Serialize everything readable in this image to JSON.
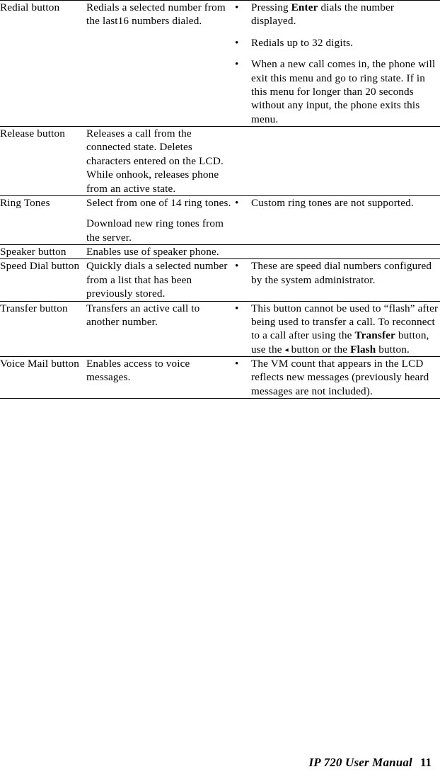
{
  "document": {
    "type": "table",
    "footer": {
      "manual_title": "IP 720 User Manual",
      "page_number": "11"
    }
  },
  "table": {
    "rows": [
      {
        "feature": "Redial button",
        "description": [
          "Redials a selected number from the last16 numbers dialed."
        ],
        "notes": [
          {
            "prefix": "Pressing ",
            "bold": "Enter",
            "suffix": " dials the number displayed."
          },
          {
            "prefix": "Redials up to 32 digits.",
            "bold": "",
            "suffix": ""
          },
          {
            "prefix": "When a new call comes in, the phone will exit this menu and go to ring state. If in this menu for longer than 20 seconds without any input, the phone exits this menu.",
            "bold": "",
            "suffix": ""
          }
        ]
      },
      {
        "feature": "Release button",
        "description": [
          "Releases a call from the connected state. Deletes characters entered on the LCD. While onhook, releases phone from an active state."
        ],
        "notes": []
      },
      {
        "feature": "Ring Tones",
        "description": [
          "Select from one of 14 ring tones.",
          "Download new ring tones from the server."
        ],
        "notes": [
          {
            "prefix": "Custom ring tones are not supported.",
            "bold": "",
            "suffix": ""
          }
        ]
      },
      {
        "feature": "Speaker button",
        "description": [
          "Enables use of speaker phone."
        ],
        "notes": []
      },
      {
        "feature": "Speed Dial button",
        "description": [
          "Quickly dials a selected number from a list that has been previously stored."
        ],
        "notes": [
          {
            "prefix": "These are speed dial numbers configured by the system administrator.",
            "bold": "",
            "suffix": ""
          }
        ]
      },
      {
        "feature": "Transfer button",
        "description": [
          "Transfers an active call to another number."
        ],
        "notes": [
          {
            "prefix": "This button cannot be used to “flash” after being used to transfer a call. To reconnect to a call after using the ",
            "bold": "Transfer",
            "middle": " button, use the ",
            "arrow": "◂",
            "middle2": " button or the ",
            "bold2": "Flash",
            "suffix": " button."
          }
        ]
      },
      {
        "feature": "Voice Mail button",
        "description": [
          "Enables access to voice messages."
        ],
        "notes": [
          {
            "prefix": "The VM count that appears in the LCD reflects new messages (previously heard messages are not included).",
            "bold": "",
            "suffix": ""
          }
        ]
      }
    ]
  },
  "glyphs": {
    "bullet": "•",
    "left_triangle": "◂"
  }
}
